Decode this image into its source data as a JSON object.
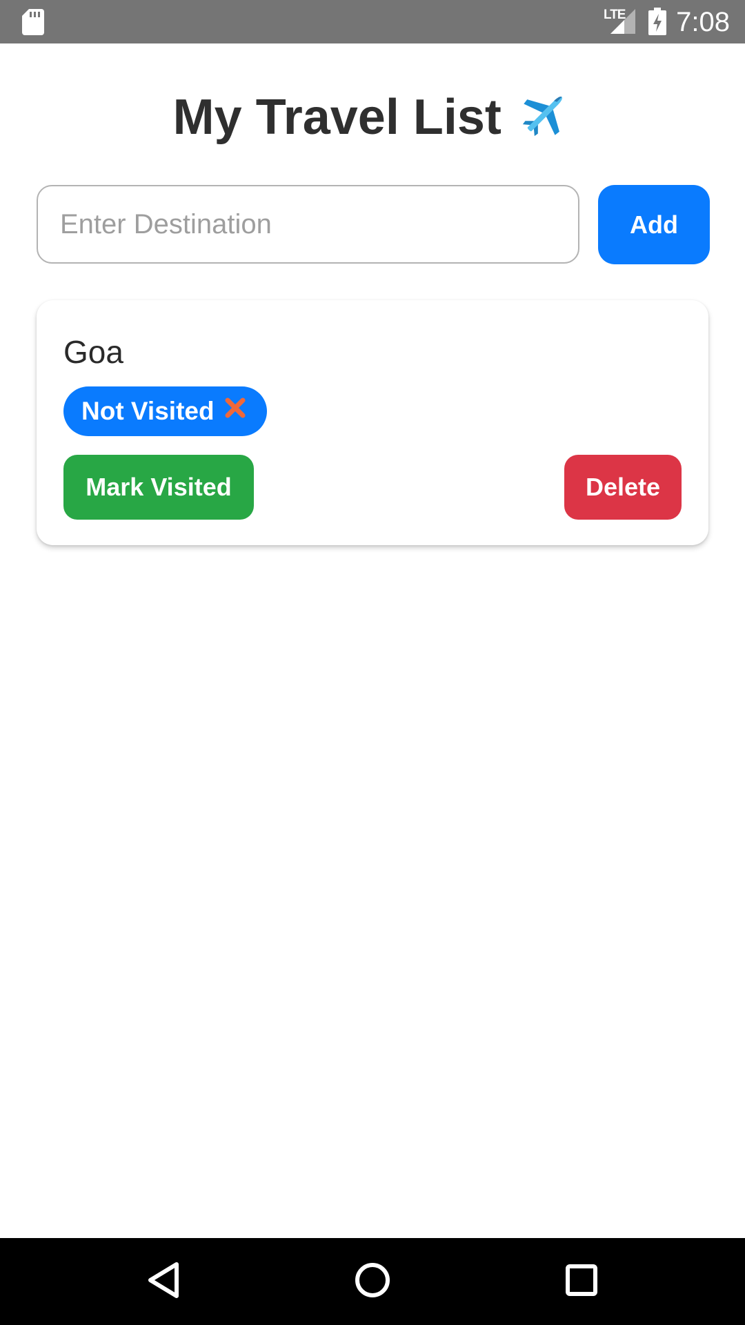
{
  "status_bar": {
    "network_label": "LTE",
    "time": "7:08",
    "icons": [
      "sd-card-icon",
      "signal-icon",
      "battery-charging-icon"
    ]
  },
  "header": {
    "title": "My Travel List",
    "title_icon": "airplane-icon"
  },
  "form": {
    "input_placeholder": "Enter Destination",
    "input_value": "",
    "add_label": "Add"
  },
  "destinations": [
    {
      "name": "Goa",
      "status_label": "Not Visited",
      "status_icon": "cross-mark-icon",
      "mark_label": "Mark Visited",
      "delete_label": "Delete"
    }
  ],
  "nav_bar": {
    "icons": [
      "back-icon",
      "home-icon",
      "recents-icon"
    ]
  },
  "colors": {
    "primary": "#0a7bfe",
    "success": "#28a745",
    "danger": "#dc3546",
    "status_bar": "#757575",
    "cross_mark": "#f0683a",
    "title_text": "#2f2f2f"
  }
}
